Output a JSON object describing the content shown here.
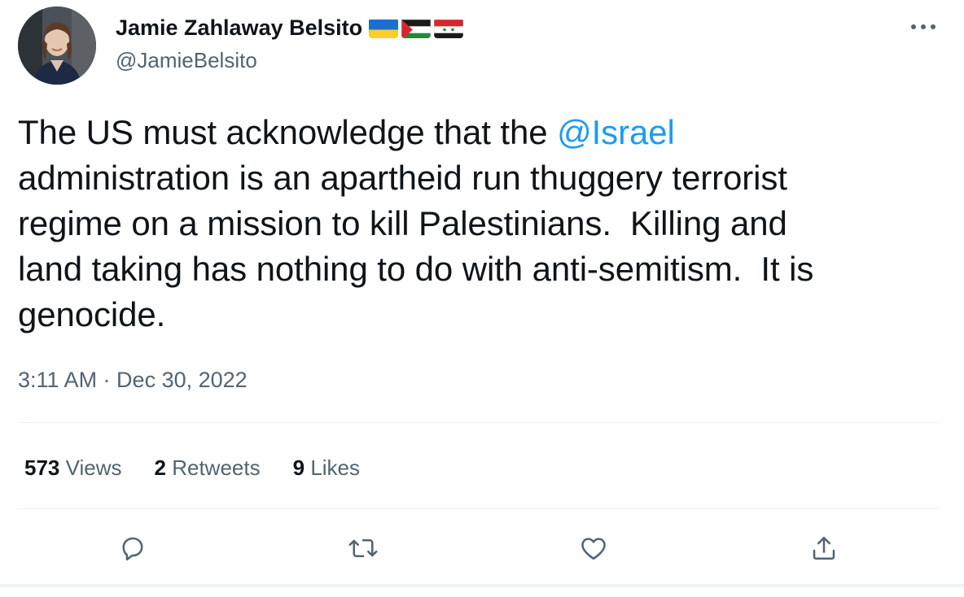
{
  "author": {
    "name": "Jamie Zahlaway Belsito",
    "handle": "@JamieBelsito",
    "flags": [
      "ukraine-flag-icon",
      "palestine-flag-icon",
      "syria-flag-icon"
    ]
  },
  "tweet": {
    "text_before": "The US must acknowledge that the ",
    "mention": "@Israel",
    "text_after": "\nadministration is an apartheid run thuggery terrorist\nregime on a mission to kill Palestinians.  Killing and\nland taking has nothing to do with anti-semitism.  It is\ngenocide.",
    "timestamp": "3:11 AM · Dec 30, 2022"
  },
  "stats": {
    "views_count": "573",
    "views_label": "Views",
    "retweets_count": "2",
    "retweets_label": "Retweets",
    "likes_count": "9",
    "likes_label": "Likes"
  },
  "actions": [
    "reply-icon",
    "retweet-icon",
    "like-icon",
    "share-icon"
  ],
  "colors": {
    "text": "#0f1419",
    "secondary": "#536471",
    "link": "#1d9bf0",
    "divider": "#eff3f4"
  }
}
